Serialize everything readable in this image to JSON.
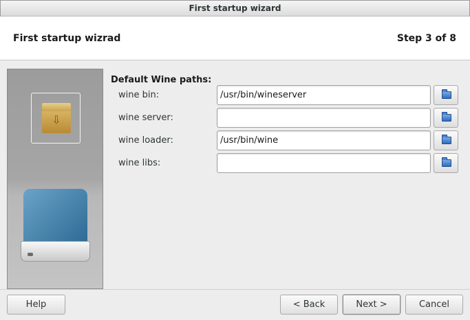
{
  "window": {
    "title": "First startup wizard"
  },
  "header": {
    "title": "First startup wizrad",
    "step": "Step 3 of 8"
  },
  "section": {
    "title": "Default Wine paths:"
  },
  "fields": [
    {
      "label": "wine bin:",
      "value": "/usr/bin/wineserver"
    },
    {
      "label": "wine server:",
      "value": ""
    },
    {
      "label": "wine loader:",
      "value": "/usr/bin/wine"
    },
    {
      "label": "wine libs:",
      "value": ""
    }
  ],
  "icons": {
    "browse": "folder-icon",
    "sidebar_top": "package-box-icon",
    "sidebar_bottom": "drive-icon"
  },
  "buttons": {
    "help": "Help",
    "back": "< Back",
    "next": "Next >",
    "cancel": "Cancel"
  }
}
